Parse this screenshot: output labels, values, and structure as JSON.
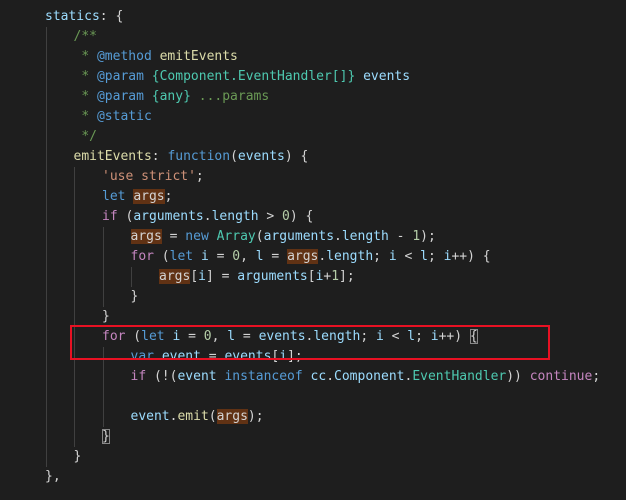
{
  "editor": {
    "lines": [
      {
        "indent": 1,
        "tokens": [
          {
            "t": "statics",
            "c": "t-prop"
          },
          {
            "t": ": {",
            "c": "t-default"
          }
        ]
      },
      {
        "indent": 2,
        "tokens": [
          {
            "t": "/**",
            "c": "t-comment"
          }
        ]
      },
      {
        "indent": 2,
        "tokens": [
          {
            "t": " * ",
            "c": "t-comment"
          },
          {
            "t": "@method",
            "c": "t-kw"
          },
          {
            "t": " ",
            "c": "t-comment"
          },
          {
            "t": "emitEvents",
            "c": "t-func"
          }
        ]
      },
      {
        "indent": 2,
        "tokens": [
          {
            "t": " * ",
            "c": "t-comment"
          },
          {
            "t": "@param",
            "c": "t-kw"
          },
          {
            "t": " ",
            "c": "t-comment"
          },
          {
            "t": "{Component.EventHandler[]}",
            "c": "t-cls"
          },
          {
            "t": " ",
            "c": "t-comment"
          },
          {
            "t": "events",
            "c": "t-var"
          }
        ]
      },
      {
        "indent": 2,
        "tokens": [
          {
            "t": " * ",
            "c": "t-comment"
          },
          {
            "t": "@param",
            "c": "t-kw"
          },
          {
            "t": " ",
            "c": "t-comment"
          },
          {
            "t": "{any}",
            "c": "t-cls"
          },
          {
            "t": " ...params",
            "c": "t-comment"
          }
        ]
      },
      {
        "indent": 2,
        "tokens": [
          {
            "t": " * ",
            "c": "t-comment"
          },
          {
            "t": "@static",
            "c": "t-kw"
          }
        ]
      },
      {
        "indent": 2,
        "tokens": [
          {
            "t": " */",
            "c": "t-comment"
          }
        ]
      },
      {
        "indent": 2,
        "tokens": [
          {
            "t": "emitEvents",
            "c": "t-func"
          },
          {
            "t": ": ",
            "c": "t-default"
          },
          {
            "t": "function",
            "c": "t-kw"
          },
          {
            "t": "(",
            "c": "t-default"
          },
          {
            "t": "events",
            "c": "t-var"
          },
          {
            "t": ") {",
            "c": "t-default"
          }
        ]
      },
      {
        "indent": 3,
        "tokens": [
          {
            "t": "'use strict'",
            "c": "t-str"
          },
          {
            "t": ";",
            "c": "t-default"
          }
        ]
      },
      {
        "indent": 3,
        "tokens": [
          {
            "t": "let",
            "c": "t-kw"
          },
          {
            "t": " ",
            "c": "t-default"
          },
          {
            "t": "args",
            "c": "t-hl"
          },
          {
            "t": ";",
            "c": "t-default"
          }
        ]
      },
      {
        "indent": 3,
        "tokens": [
          {
            "t": "if",
            "c": "t-ctrl"
          },
          {
            "t": " (",
            "c": "t-default"
          },
          {
            "t": "arguments",
            "c": "t-var"
          },
          {
            "t": ".",
            "c": "t-default"
          },
          {
            "t": "length",
            "c": "t-prop"
          },
          {
            "t": " > ",
            "c": "t-default"
          },
          {
            "t": "0",
            "c": "t-num"
          },
          {
            "t": ") {",
            "c": "t-default"
          }
        ]
      },
      {
        "indent": 4,
        "tokens": [
          {
            "t": "args",
            "c": "t-hl"
          },
          {
            "t": " = ",
            "c": "t-default"
          },
          {
            "t": "new",
            "c": "t-kw"
          },
          {
            "t": " ",
            "c": "t-default"
          },
          {
            "t": "Array",
            "c": "t-cls"
          },
          {
            "t": "(",
            "c": "t-default"
          },
          {
            "t": "arguments",
            "c": "t-var"
          },
          {
            "t": ".",
            "c": "t-default"
          },
          {
            "t": "length",
            "c": "t-prop"
          },
          {
            "t": " - ",
            "c": "t-default"
          },
          {
            "t": "1",
            "c": "t-num"
          },
          {
            "t": ");",
            "c": "t-default"
          }
        ]
      },
      {
        "indent": 4,
        "tokens": [
          {
            "t": "for",
            "c": "t-ctrl"
          },
          {
            "t": " (",
            "c": "t-default"
          },
          {
            "t": "let",
            "c": "t-kw"
          },
          {
            "t": " ",
            "c": "t-default"
          },
          {
            "t": "i",
            "c": "t-var"
          },
          {
            "t": " = ",
            "c": "t-default"
          },
          {
            "t": "0",
            "c": "t-num"
          },
          {
            "t": ", ",
            "c": "t-default"
          },
          {
            "t": "l",
            "c": "t-var"
          },
          {
            "t": " = ",
            "c": "t-default"
          },
          {
            "t": "args",
            "c": "t-hl"
          },
          {
            "t": ".",
            "c": "t-default"
          },
          {
            "t": "length",
            "c": "t-prop"
          },
          {
            "t": "; ",
            "c": "t-default"
          },
          {
            "t": "i",
            "c": "t-var"
          },
          {
            "t": " < ",
            "c": "t-default"
          },
          {
            "t": "l",
            "c": "t-var"
          },
          {
            "t": "; ",
            "c": "t-default"
          },
          {
            "t": "i",
            "c": "t-var"
          },
          {
            "t": "++) {",
            "c": "t-default"
          }
        ]
      },
      {
        "indent": 5,
        "tokens": [
          {
            "t": "args",
            "c": "t-hl"
          },
          {
            "t": "[",
            "c": "t-default"
          },
          {
            "t": "i",
            "c": "t-var"
          },
          {
            "t": "] = ",
            "c": "t-default"
          },
          {
            "t": "arguments",
            "c": "t-var"
          },
          {
            "t": "[",
            "c": "t-default"
          },
          {
            "t": "i",
            "c": "t-var"
          },
          {
            "t": "+",
            "c": "t-default"
          },
          {
            "t": "1",
            "c": "t-num"
          },
          {
            "t": "];",
            "c": "t-default"
          }
        ]
      },
      {
        "indent": 4,
        "tokens": [
          {
            "t": "}",
            "c": "t-default"
          }
        ]
      },
      {
        "indent": 3,
        "tokens": [
          {
            "t": "}",
            "c": "t-default"
          }
        ]
      },
      {
        "indent": 3,
        "tokens": [
          {
            "t": "for",
            "c": "t-ctrl"
          },
          {
            "t": " (",
            "c": "t-default"
          },
          {
            "t": "let",
            "c": "t-kw"
          },
          {
            "t": " ",
            "c": "t-default"
          },
          {
            "t": "i",
            "c": "t-var"
          },
          {
            "t": " = ",
            "c": "t-default"
          },
          {
            "t": "0",
            "c": "t-num"
          },
          {
            "t": ", ",
            "c": "t-default"
          },
          {
            "t": "l",
            "c": "t-var"
          },
          {
            "t": " = ",
            "c": "t-default"
          },
          {
            "t": "events",
            "c": "t-var"
          },
          {
            "t": ".",
            "c": "t-default"
          },
          {
            "t": "length",
            "c": "t-prop"
          },
          {
            "t": "; ",
            "c": "t-default"
          },
          {
            "t": "i",
            "c": "t-var"
          },
          {
            "t": " < ",
            "c": "t-default"
          },
          {
            "t": "l",
            "c": "t-var"
          },
          {
            "t": "; ",
            "c": "t-default"
          },
          {
            "t": "i",
            "c": "t-var"
          },
          {
            "t": "++) ",
            "c": "t-default"
          },
          {
            "t": "{",
            "c": "t-bracket"
          }
        ]
      },
      {
        "indent": 4,
        "tokens": [
          {
            "t": "var",
            "c": "t-kw"
          },
          {
            "t": " ",
            "c": "t-default"
          },
          {
            "t": "event",
            "c": "t-var"
          },
          {
            "t": " = ",
            "c": "t-default"
          },
          {
            "t": "events",
            "c": "t-var"
          },
          {
            "t": "[",
            "c": "t-default"
          },
          {
            "t": "i",
            "c": "t-var"
          },
          {
            "t": "];",
            "c": "t-default"
          }
        ]
      },
      {
        "indent": 4,
        "tokens": [
          {
            "t": "if",
            "c": "t-ctrl"
          },
          {
            "t": " (!(",
            "c": "t-default"
          },
          {
            "t": "event",
            "c": "t-var"
          },
          {
            "t": " ",
            "c": "t-default"
          },
          {
            "t": "instanceof",
            "c": "t-kw"
          },
          {
            "t": " ",
            "c": "t-default"
          },
          {
            "t": "cc",
            "c": "t-var"
          },
          {
            "t": ".",
            "c": "t-default"
          },
          {
            "t": "Component",
            "c": "t-var"
          },
          {
            "t": ".",
            "c": "t-default"
          },
          {
            "t": "EventHandler",
            "c": "t-cls"
          },
          {
            "t": ")) ",
            "c": "t-default"
          },
          {
            "t": "continue",
            "c": "t-ctrl"
          },
          {
            "t": ";",
            "c": "t-default"
          }
        ]
      },
      {
        "indent": 4,
        "tokens": []
      },
      {
        "indent": 4,
        "tokens": [
          {
            "t": "event",
            "c": "t-var"
          },
          {
            "t": ".",
            "c": "t-default"
          },
          {
            "t": "emit",
            "c": "t-func"
          },
          {
            "t": "(",
            "c": "t-default"
          },
          {
            "t": "args",
            "c": "t-hl"
          },
          {
            "t": ");",
            "c": "t-default"
          }
        ]
      },
      {
        "indent": 3,
        "tokens": [
          {
            "t": "}",
            "c": "t-bracket"
          }
        ]
      },
      {
        "indent": 2,
        "tokens": [
          {
            "t": "}",
            "c": "t-default"
          }
        ]
      },
      {
        "indent": 1,
        "tokens": [
          {
            "t": "},",
            "c": "t-default"
          }
        ]
      }
    ]
  },
  "colors": {
    "background": "#1e1e1e",
    "highlight_box": "#e81123",
    "word_highlight": "#613214",
    "indent_guide": "#404040"
  }
}
